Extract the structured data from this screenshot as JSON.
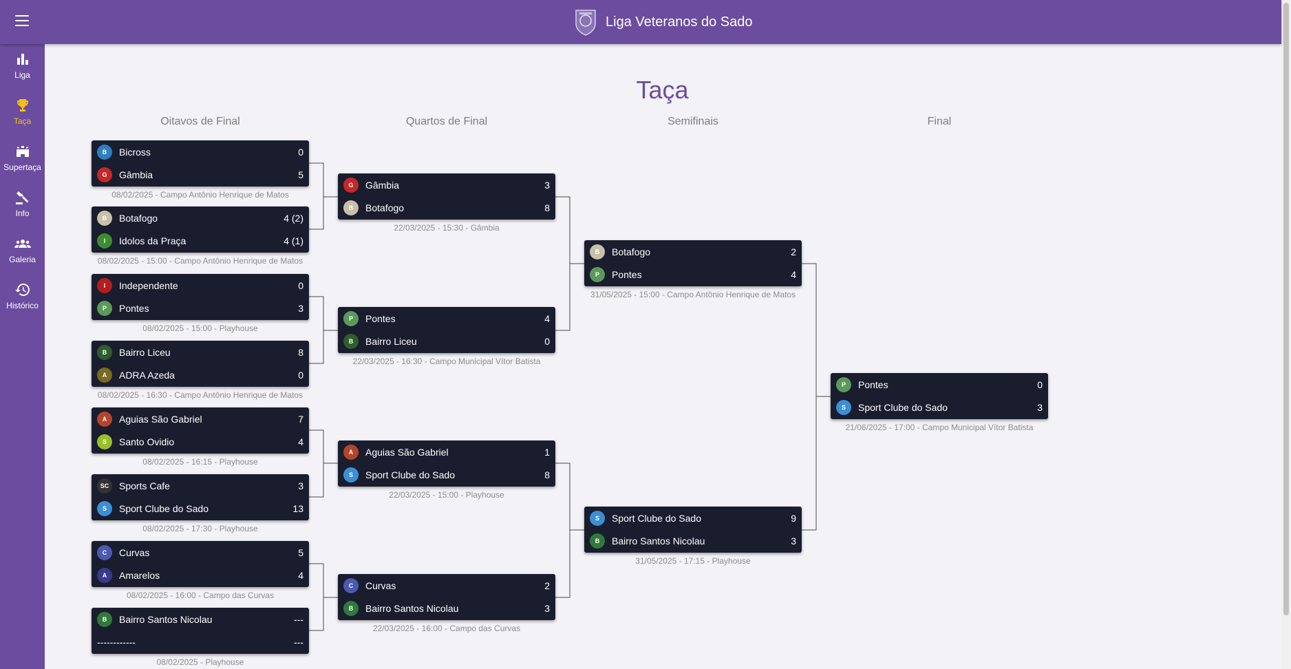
{
  "app": {
    "title": "Liga Veteranos do Sado",
    "menu_icon": "menu-icon",
    "logo_icon": "league-crest-icon"
  },
  "sidebar": {
    "items": [
      {
        "label": "Liga",
        "icon": "bar-chart-icon",
        "active": false
      },
      {
        "label": "Taça",
        "icon": "trophy-icon",
        "active": true
      },
      {
        "label": "Supertaça",
        "icon": "stadium-icon",
        "active": false
      },
      {
        "label": "Info",
        "icon": "gavel-icon",
        "active": false
      },
      {
        "label": "Galeria",
        "icon": "people-icon",
        "active": false
      },
      {
        "label": "Histórico",
        "icon": "history-icon",
        "active": false
      }
    ]
  },
  "page": {
    "title": "Taça"
  },
  "rounds": [
    {
      "title": "Oitavos de Final"
    },
    {
      "title": "Quartos de Final"
    },
    {
      "title": "Semifinais"
    },
    {
      "title": "Final"
    }
  ],
  "colors": {
    "accent": "#6b4c9e",
    "active_nav": "#f4c20d",
    "card": "#1a1d2e"
  },
  "matches": [
    {
      "home": "Bicross",
      "home_score": "0",
      "away": "Gâmbia",
      "away_score": "5",
      "info": "08/02/2025 - Campo Antônio Henrique de Matos"
    },
    {
      "home": "Botafogo",
      "home_score": "4 (2)",
      "away": "Idolos da Praça",
      "away_score": "4 (1)",
      "info": "08/02/2025 - 15:00 - Campo Antônio Henrique de Matos"
    },
    {
      "home": "Independente",
      "home_score": "0",
      "away": "Pontes",
      "away_score": "3",
      "info": "08/02/2025 - 15:00 - Playhouse"
    },
    {
      "home": "Bairro Liceu",
      "home_score": "8",
      "away": "ADRA Azeda",
      "away_score": "0",
      "info": "08/02/2025 - 16:30 - Campo Antônio Henrique de Matos"
    },
    {
      "home": "Aguias São Gabriel",
      "home_score": "7",
      "away": "Santo Ovidio",
      "away_score": "4",
      "info": "08/02/2025 - 16:15 - Playhouse"
    },
    {
      "home": "Sports Cafe",
      "home_score": "3",
      "away": "Sport Clube do Sado",
      "away_score": "13",
      "info": "08/02/2025 - 17:30 - Playhouse"
    },
    {
      "home": "Curvas",
      "home_score": "5",
      "away": "Amarelos",
      "away_score": "4",
      "info": "08/02/2025 - 16:00 - Campo das Curvas"
    },
    {
      "home": "Bairro Santos Nicolau",
      "home_score": "---",
      "away": "------------",
      "away_score": "---",
      "info": "08/02/2025 - Playhouse"
    },
    {
      "home": "Gâmbia",
      "home_score": "3",
      "away": "Botafogo",
      "away_score": "8",
      "info": "22/03/2025 - 15:30 - Gâmbia"
    },
    {
      "home": "Pontes",
      "home_score": "4",
      "away": "Bairro Liceu",
      "away_score": "0",
      "info": "22/03/2025 - 16:30 - Campo Municipal Vítor Batista"
    },
    {
      "home": "Aguias São Gabriel",
      "home_score": "1",
      "away": "Sport Clube do Sado",
      "away_score": "8",
      "info": "22/03/2025 - 15:00 - Playhouse"
    },
    {
      "home": "Curvas",
      "home_score": "2",
      "away": "Bairro Santos Nicolau",
      "away_score": "3",
      "info": "22/03/2025 - 16:00 - Campo das Curvas"
    },
    {
      "home": "Botafogo",
      "home_score": "2",
      "away": "Pontes",
      "away_score": "4",
      "info": "31/05/2025 - 15:00 - Campo Antônio Henrique de Matos"
    },
    {
      "home": "Sport Clube do Sado",
      "home_score": "9",
      "away": "Bairro Santos Nicolau",
      "away_score": "3",
      "info": "31/05/2025 - 17:15 - Playhouse"
    },
    {
      "home": "Pontes",
      "home_score": "0",
      "away": "Sport Clube do Sado",
      "away_score": "3",
      "info": "21/06/2025 - 17:00 - Campo Municipal Vítor Batista"
    }
  ]
}
